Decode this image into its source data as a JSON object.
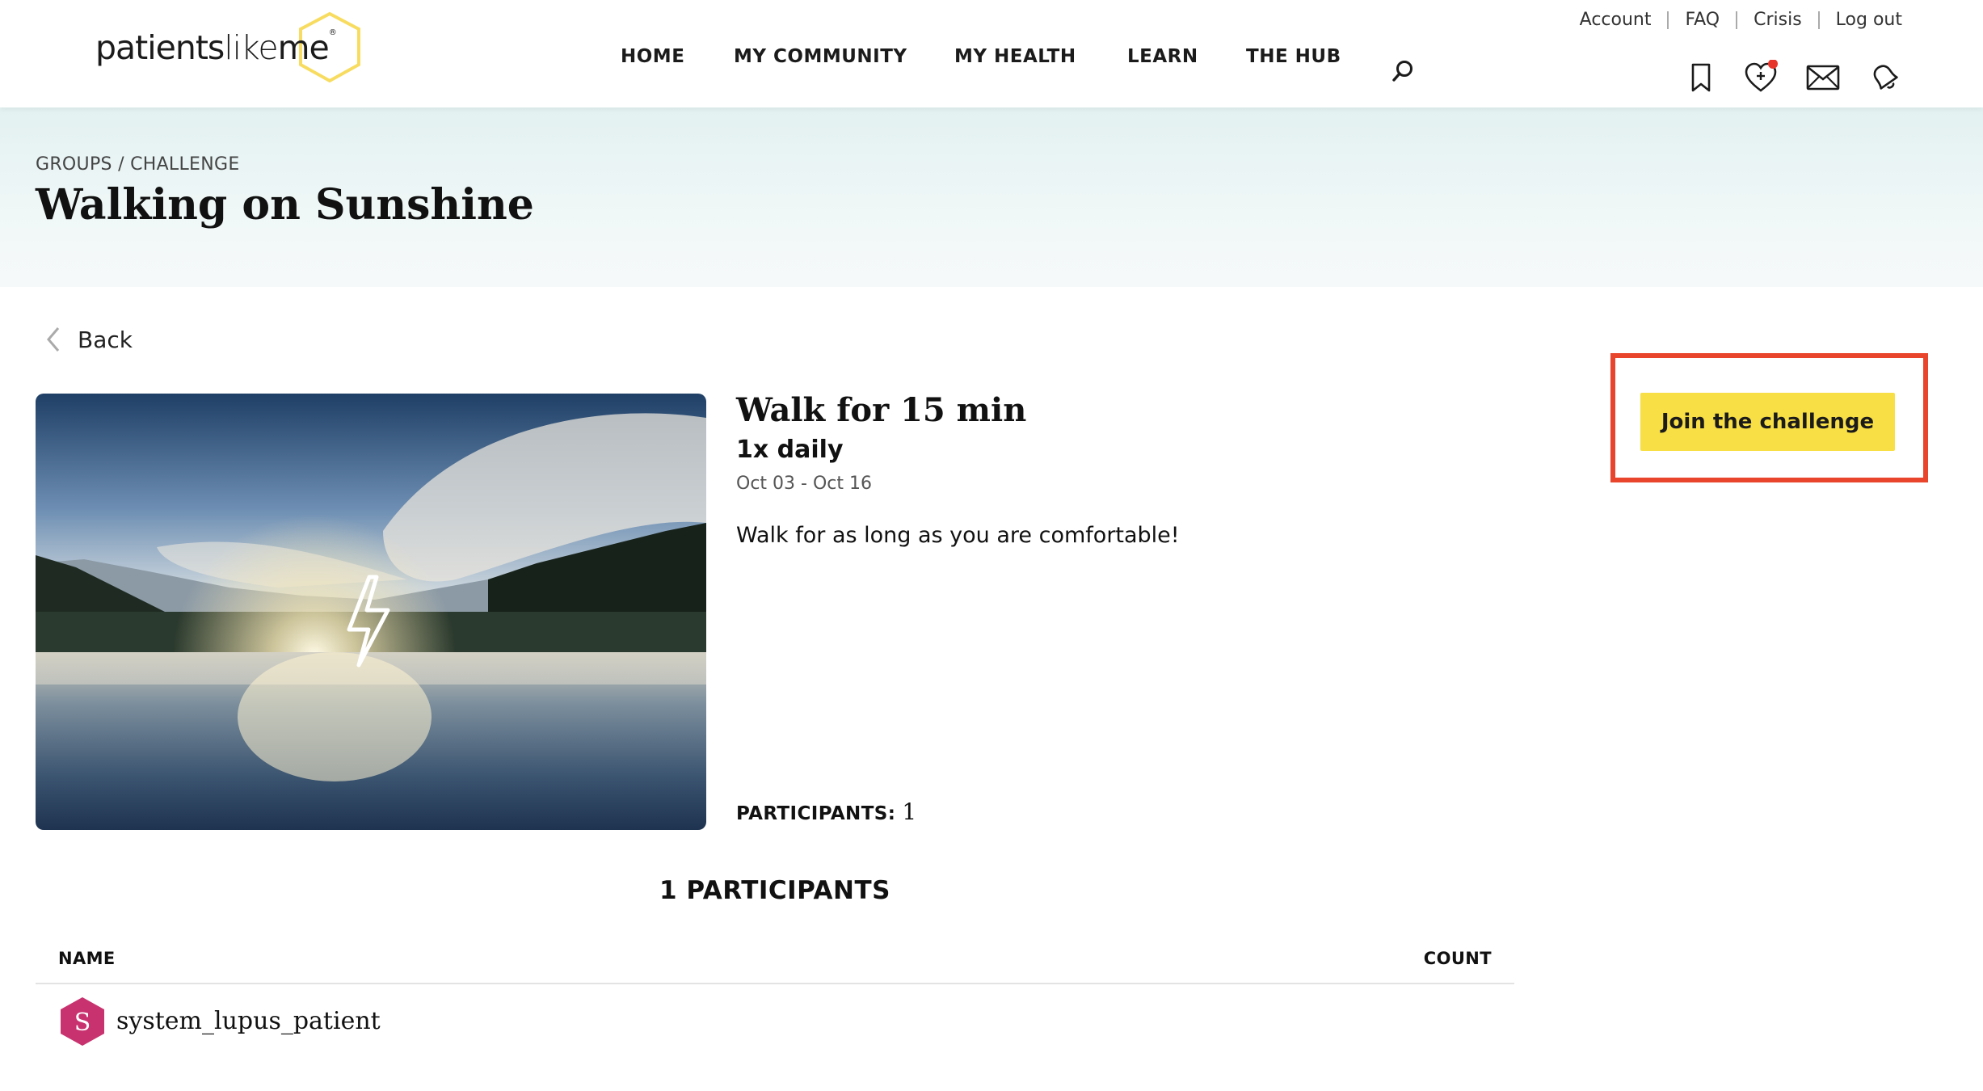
{
  "brand": {
    "logo_text_bold": "patients",
    "logo_text_light": "like",
    "logo_text_end": "me",
    "logo_reg": "®",
    "hex_color": "#f7dc60"
  },
  "topnav": {
    "account": "Account",
    "faq": "FAQ",
    "crisis": "Crisis",
    "logout": "Log out"
  },
  "mainnav": {
    "home": "HOME",
    "community": "MY COMMUNITY",
    "health": "MY HEALTH",
    "learn": "LEARN",
    "hub": "THE HUB"
  },
  "header_icons": [
    "bookmark-icon",
    "heart-plus-icon",
    "mail-icon",
    "bell-icon"
  ],
  "notification_dot_color": "#e8352c",
  "banner": {
    "breadcrumb": "GROUPS / CHALLENGE",
    "title": "Walking on Sunshine"
  },
  "back": {
    "label": "Back"
  },
  "challenge": {
    "title": "Walk for 15 min",
    "frequency": "1x daily",
    "dates": "Oct 03 - Oct 16",
    "description": "Walk for as long as you are comfortable!",
    "participants_label": "PARTICIPANTS:",
    "participants_count": "1",
    "join_label": "Join the challenge",
    "join_color": "#f8df45",
    "highlight_color": "#e8452c"
  },
  "participants_list": {
    "heading": "1 PARTICIPANTS",
    "col_name": "NAME",
    "col_count": "COUNT",
    "rows": [
      {
        "avatar_letter": "S",
        "avatar_color": "#c8336f",
        "username": "system_lupus_patient"
      }
    ]
  }
}
